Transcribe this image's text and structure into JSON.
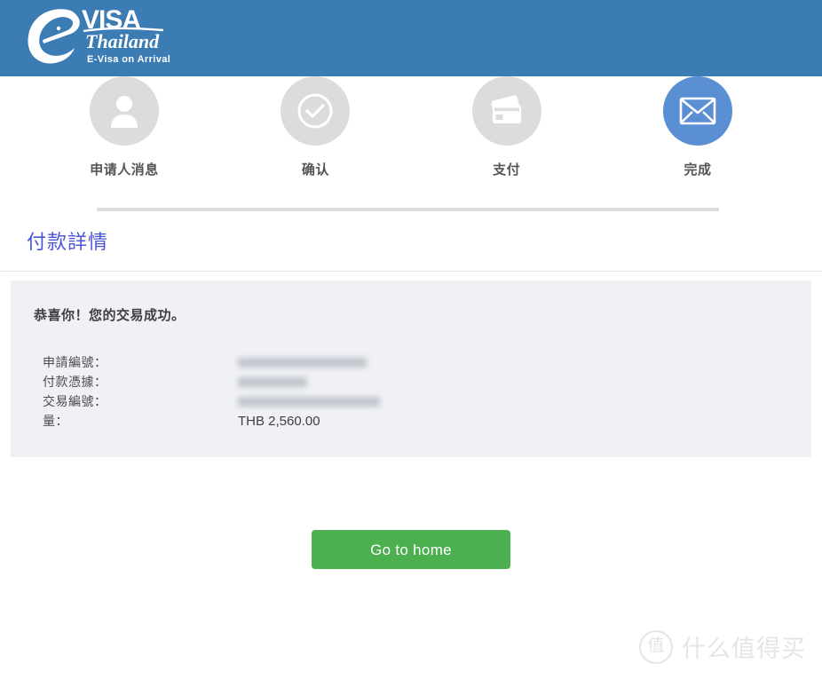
{
  "header": {
    "logo": {
      "mark": "e",
      "title": "VISA",
      "script": "Thailand",
      "tagline": "E-Visa on Arrival",
      "background_color": "#3b7cb5"
    }
  },
  "stepper": {
    "active_color": "#5b8fd4",
    "inactive_color": "#dcdcdc",
    "steps": [
      {
        "label": "申请人消息",
        "icon": "person-icon",
        "active": false
      },
      {
        "label": "确认",
        "icon": "check-circle-icon",
        "active": false
      },
      {
        "label": "支付",
        "icon": "credit-card-icon",
        "active": false
      },
      {
        "label": "完成",
        "icon": "envelope-icon",
        "active": true
      }
    ]
  },
  "main": {
    "title": "付款詳情",
    "title_color": "#4a56d6",
    "panel": {
      "background_color": "#eff1f5",
      "success_message": "恭喜你！您的交易成功。",
      "details": [
        {
          "label": "申請編號：",
          "value": "",
          "redacted": true
        },
        {
          "label": "付款憑據：",
          "value": "",
          "redacted": true
        },
        {
          "label": "交易編號：",
          "value": "",
          "redacted": true
        },
        {
          "label": "量：",
          "value": "THB 2,560.00",
          "redacted": false
        }
      ]
    },
    "home_button": {
      "label": "Go to home",
      "color": "#4caf50"
    }
  },
  "watermark": {
    "badge": "值",
    "text": "什么值得买",
    "color": "#e3e5e9"
  }
}
